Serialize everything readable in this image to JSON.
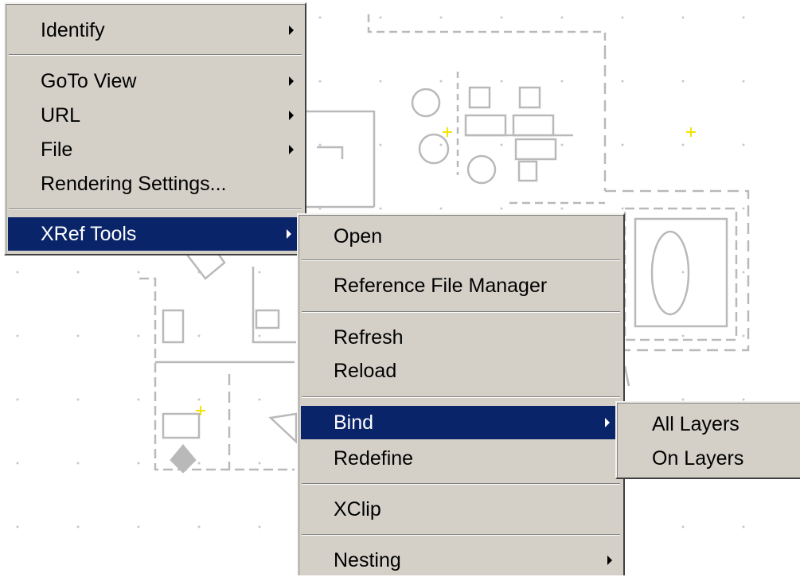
{
  "main_menu": {
    "items": [
      {
        "label": "Identify"
      },
      {
        "label": "GoTo View"
      },
      {
        "label": "URL"
      },
      {
        "label": "File"
      },
      {
        "label": "Rendering Settings..."
      },
      {
        "label": "XRef Tools"
      }
    ]
  },
  "xref_menu": {
    "items": [
      {
        "label": "Open"
      },
      {
        "label": "Reference File Manager"
      },
      {
        "label": "Refresh"
      },
      {
        "label": "Reload"
      },
      {
        "label": "Bind"
      },
      {
        "label": "Redefine"
      },
      {
        "label": "XClip"
      },
      {
        "label": "Nesting"
      }
    ]
  },
  "bind_menu": {
    "items": [
      {
        "label": "All Layers"
      },
      {
        "label": "On Layers"
      }
    ]
  },
  "colors": {
    "menu_bg": "#d4d0c8",
    "highlight": "#0a246a",
    "drawing_lines": "#b9b9b9",
    "cursor_marks": "#f5e400"
  }
}
